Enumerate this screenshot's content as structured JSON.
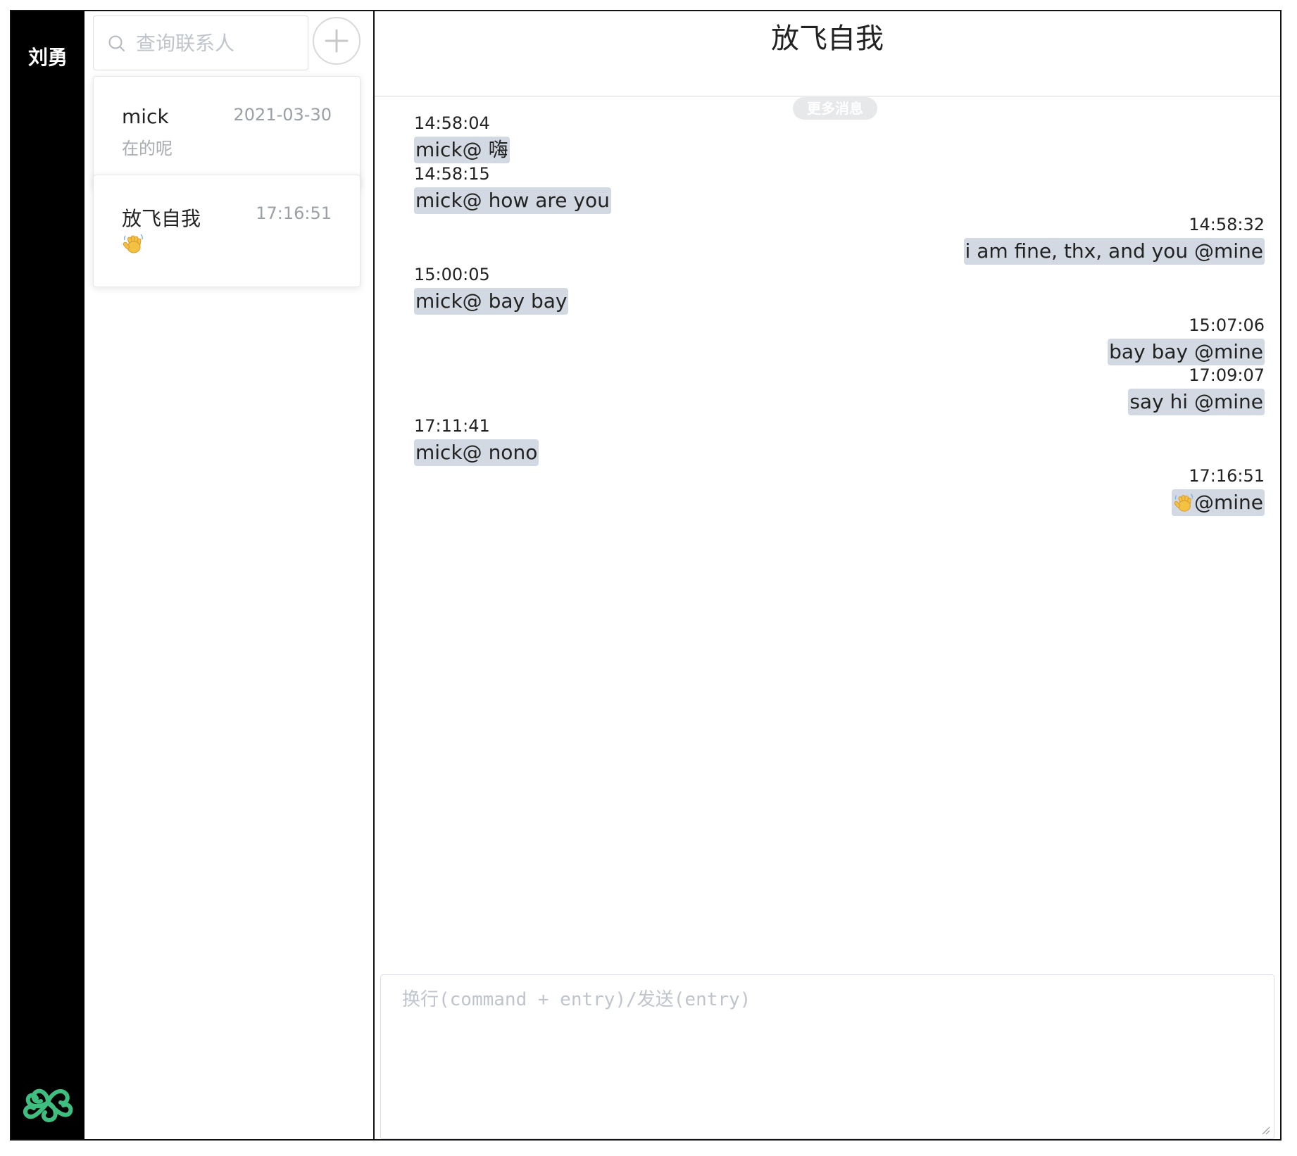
{
  "sidebar": {
    "user_name": "刘勇",
    "logo_icon": "triskele-logo-icon",
    "logo_color": "#3fbf7f"
  },
  "contacts": {
    "search_placeholder": "查询联系人",
    "add_icon": "plus-circle-icon",
    "items": [
      {
        "name": "mick",
        "time": "2021-03-30",
        "preview": "在的呢"
      },
      {
        "name": "放飞自我",
        "time": "17:16:51",
        "preview_icon": "waving-hand-icon"
      }
    ]
  },
  "chat": {
    "title": "放飞自我",
    "more_label": "更多消息",
    "messages": [
      {
        "side": "left",
        "time": "14:58:04",
        "text": "mick@ 嗨"
      },
      {
        "side": "left",
        "time": "14:58:15",
        "text": "mick@ how are you"
      },
      {
        "side": "right",
        "time": "14:58:32",
        "text": "i am fine, thx, and you @mine"
      },
      {
        "side": "left",
        "time": "15:00:05",
        "text": "mick@ bay bay"
      },
      {
        "side": "right",
        "time": "15:07:06",
        "text": "bay bay @mine"
      },
      {
        "side": "right",
        "time": "17:09:07",
        "text": "say hi @mine"
      },
      {
        "side": "left",
        "time": "17:11:41",
        "text": "mick@ nono"
      },
      {
        "side": "right",
        "time": "17:16:51",
        "text": "@mine",
        "icon": "waving-hand-icon"
      }
    ],
    "input_placeholder": "换行(command + entry)/发送(entry)"
  },
  "colors": {
    "bubble": "#d3d9e2",
    "rail": "#000000"
  }
}
